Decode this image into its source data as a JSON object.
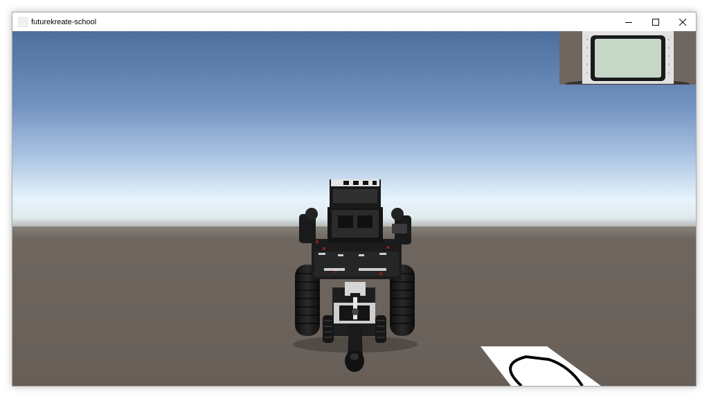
{
  "window": {
    "title": "futurekreate-school",
    "controls": {
      "minimize": "minimize-icon",
      "maximize": "maximize-icon",
      "close": "close-icon"
    }
  },
  "scene": {
    "sky_top": "#4f6f9e",
    "sky_mid": "#8eaad4",
    "horizon": "#e8f4fb",
    "ground": "#6a625b",
    "robot_body": "#1b1b1b",
    "robot_accent": "#8a1a1a",
    "robot_light": "#d8d8d8",
    "mat": "#ffffff",
    "mat_line": "#000000"
  },
  "minicam": {
    "screen_color": "#c9d8c9",
    "frame_color": "#e6e6e6"
  }
}
